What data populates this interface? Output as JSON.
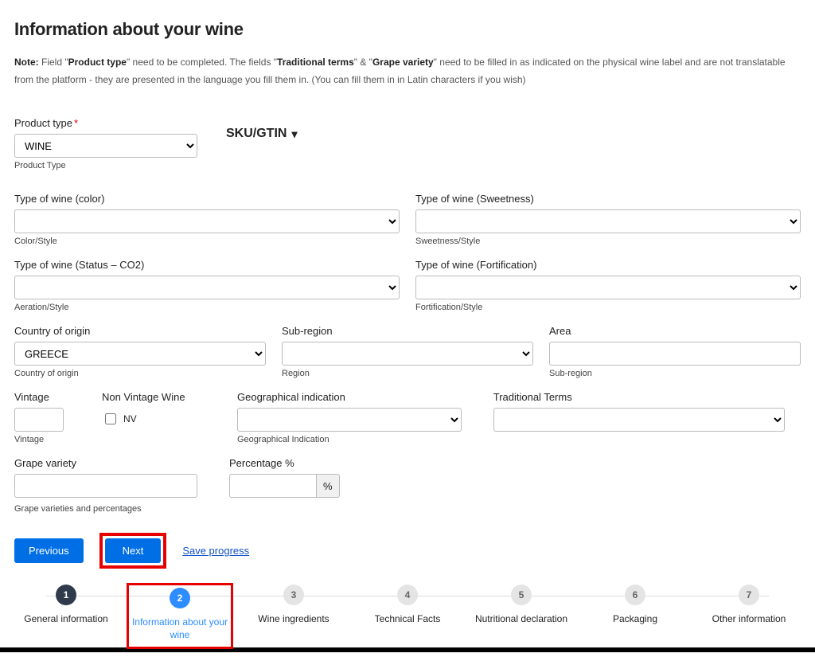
{
  "header": {
    "title": "Information about your wine"
  },
  "note": {
    "label": "Note:",
    "t1": " Field \"",
    "b1": "Product type",
    "t2": "\" need to be completed. The fields \"",
    "b2": "Traditional terms",
    "t3": "\" & \"",
    "b3": "Grape variety",
    "t4": "\" need to be filled in as indicated on the physical wine label and are not translatable from the platform - they are presented in the language you fill them in. (You can fill them in in Latin characters if you wish)"
  },
  "product_type": {
    "label": "Product type",
    "value": "WINE",
    "helper": "Product Type"
  },
  "sku": {
    "label": "SKU/GTIN"
  },
  "color": {
    "label": "Type of wine (color)",
    "value": "",
    "helper": "Color/Style"
  },
  "sweetness": {
    "label": "Type of wine (Sweetness)",
    "value": "",
    "helper": "Sweetness/Style"
  },
  "status": {
    "label": "Type of wine (Status – CO2)",
    "value": "",
    "helper": "Aeration/Style"
  },
  "fortification": {
    "label": "Type of wine (Fortification)",
    "value": "",
    "helper": "Fortification/Style"
  },
  "country": {
    "label": "Country of origin",
    "value": "GREECE",
    "helper": "Country of origin"
  },
  "subregion": {
    "label": "Sub-region",
    "value": "",
    "helper": "Region"
  },
  "area": {
    "label": "Area",
    "value": "",
    "helper": "Sub-region"
  },
  "vintage": {
    "label": "Vintage",
    "value": "",
    "helper": "Vintage"
  },
  "nv": {
    "group_label": "Non Vintage Wine",
    "checkbox_label": "NV"
  },
  "geo": {
    "label": "Geographical indication",
    "value": "",
    "helper": "Geographical Indication"
  },
  "trad": {
    "label": "Traditional Terms",
    "value": ""
  },
  "grape": {
    "label": "Grape variety",
    "value": ""
  },
  "percentage": {
    "label": "Percentage %",
    "value": "",
    "suffix": "%"
  },
  "grape_helper": "Grape varieties and percentages",
  "buttons": {
    "prev": "Previous",
    "next": "Next",
    "save": "Save progress"
  },
  "steps": [
    {
      "num": "1",
      "label": "General information",
      "state": "done"
    },
    {
      "num": "2",
      "label": "Information about your wine",
      "state": "active"
    },
    {
      "num": "3",
      "label": "Wine ingredients",
      "state": ""
    },
    {
      "num": "4",
      "label": "Technical Facts",
      "state": ""
    },
    {
      "num": "5",
      "label": "Nutritional declaration",
      "state": ""
    },
    {
      "num": "6",
      "label": "Packaging",
      "state": ""
    },
    {
      "num": "7",
      "label": "Other information",
      "state": ""
    }
  ]
}
